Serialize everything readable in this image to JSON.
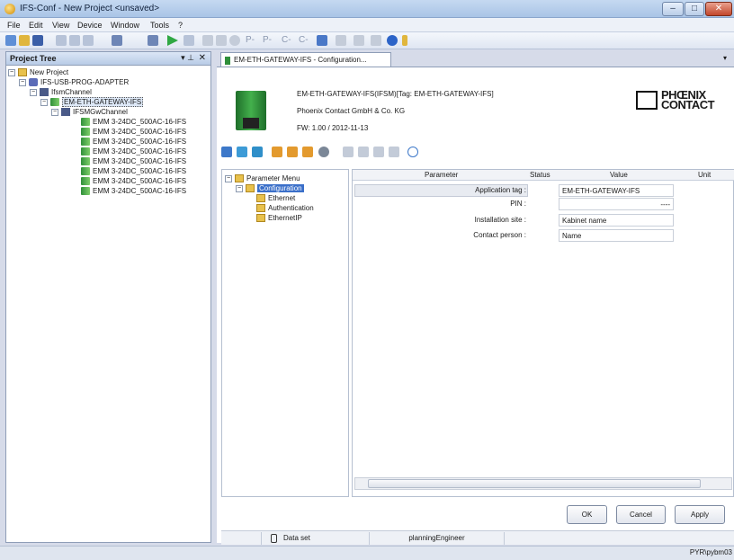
{
  "window": {
    "title": "IFS-Conf - New Project <unsaved>",
    "min": "–",
    "max": "□",
    "close": "✕"
  },
  "menu": [
    "File",
    "Edit",
    "View",
    "Device",
    "Window",
    "Tools",
    "?"
  ],
  "toolbar": {
    "text_buttons": [
      "P-",
      "P-",
      "C-",
      "C-"
    ]
  },
  "project_tree": {
    "header": "Project Tree",
    "pin": "▾ ⊥",
    "close": "✕",
    "nodes": [
      {
        "label": "New Project"
      },
      {
        "label": "IFS-USB-PROG-ADAPTER"
      },
      {
        "label": "IfsmChannel"
      },
      {
        "label": "EM-ETH-GATEWAY-IFS"
      },
      {
        "label": "IFSMGwChannel"
      },
      {
        "label": "EMM 3-24DC_500AC-16-IFS"
      },
      {
        "label": "EMM 3-24DC_500AC-16-IFS"
      },
      {
        "label": "EMM 3-24DC_500AC-16-IFS"
      },
      {
        "label": "EMM 3-24DC_500AC-16-IFS"
      },
      {
        "label": "EMM 3-24DC_500AC-16-IFS"
      },
      {
        "label": "EMM 3-24DC_500AC-16-IFS"
      },
      {
        "label": "EMM 3-24DC_500AC-16-IFS"
      },
      {
        "label": "EMM 3-24DC_500AC-16-IFS"
      }
    ]
  },
  "document_tab": {
    "label": "EM-ETH-GATEWAY-IFS - Configuration..."
  },
  "device_header": {
    "title": "EM-ETH-GATEWAY-IFS(IFSM)[Tag: EM-ETH-GATEWAY-IFS]",
    "vendor": "Phoenix Contact GmbH & Co. KG",
    "firmware": "FW: 1.00 / 2012-11-13",
    "logo_line1": "PHŒNIX",
    "logo_line2": "CONTACT"
  },
  "parameter_menu": {
    "root": "Parameter Menu",
    "selected": "Configuration",
    "children": [
      "Ethernet",
      "Authentication",
      "EthernetIP"
    ]
  },
  "grid": {
    "headers": {
      "parameter": "Parameter",
      "status": "Status",
      "value": "Value",
      "unit": "Unit"
    },
    "rows": [
      {
        "parameter": "Application tag :",
        "value": "EM-ETH-GATEWAY-IFS"
      },
      {
        "parameter": "PIN :",
        "value": "----"
      },
      {
        "parameter": "Installation site :",
        "value": "Kabinet name"
      },
      {
        "parameter": "Contact person :",
        "value": "Name"
      }
    ]
  },
  "buttons": {
    "ok": "OK",
    "cancel": "Cancel",
    "apply": "Apply"
  },
  "status": {
    "dataset": "Data set",
    "role": "planningEngineer",
    "user": "PYR\\pybm03"
  }
}
